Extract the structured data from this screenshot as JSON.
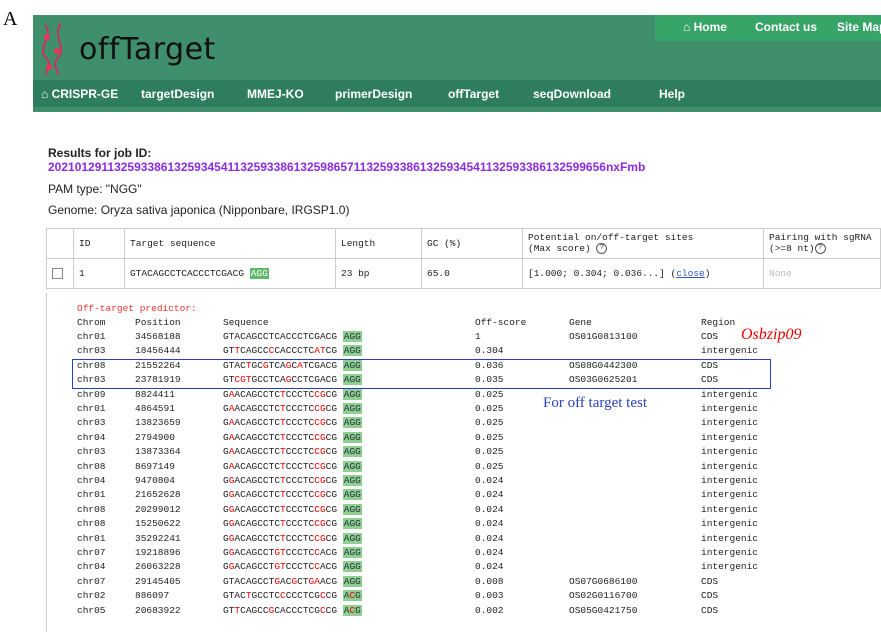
{
  "panel_label": "A",
  "logo": {
    "text": "offTarget"
  },
  "topnav": [
    {
      "label": "Home",
      "icon": "home-icon"
    },
    {
      "label": "Contact us"
    },
    {
      "label": "Site Map"
    }
  ],
  "mainnav": [
    {
      "label": "CRISPR-GE",
      "icon": "home-icon"
    },
    {
      "label": "targetDesign"
    },
    {
      "label": "MMEJ-KO"
    },
    {
      "label": "primerDesign"
    },
    {
      "label": "offTarget"
    },
    {
      "label": "seqDownload"
    },
    {
      "label": "Help"
    }
  ],
  "job": {
    "label": "Results for job ID:",
    "id": "20210129113259338613259345411325933861325986571132593386132593454113259338613259965​6nxFmb",
    "pam": "PAM type:  \"NGG\"",
    "genome": "Genome:  Oryza sativa japonica (Nipponbare, IRGSP1.0)"
  },
  "table": {
    "headers": [
      "ID",
      "Target sequence",
      "Length",
      "GC (%)",
      "Potential on/off-target sites",
      "(Max score)",
      "Pairing with sgRNA",
      "(>=8 nt)"
    ],
    "row": {
      "id": "1",
      "seq": "GTACAGCCTCACCCTCGACG",
      "pam": "AGG",
      "length": "23 bp",
      "gc": "65.0",
      "sites": "[1.000; 0.304; 0.036...] (",
      "sites_link": "close",
      "sites_end": ")",
      "pairing": "None"
    }
  },
  "offtarget": {
    "title": "Off-target predictor:",
    "columns": [
      "Chrom",
      "Position",
      "Sequence",
      "Off-score",
      "Gene",
      "Region"
    ],
    "rows": [
      {
        "chrom": "chr01",
        "pos": "34568188",
        "seq": "GTACAGCCTCACCCTCGACG",
        "pam": "AGG",
        "score": "1",
        "gene": "OS01G0813100",
        "region": "CDS"
      },
      {
        "chrom": "chr03",
        "pos": "18456444",
        "seq": "GTTCAGCCCCACCCTCATCG",
        "pam": "AGG",
        "score": "0.304",
        "gene": "",
        "region": "intergenic"
      },
      {
        "chrom": "chr08",
        "pos": "21552264",
        "seq": "GTACTGCGTCAGCATCGACG",
        "pam": "AGG",
        "score": "0.036",
        "gene": "OS08G0442300",
        "region": "CDS"
      },
      {
        "chrom": "chr03",
        "pos": "23781919",
        "seq": "GTCGTGCCTCAGCCTCGACG",
        "pam": "AGG",
        "score": "0.035",
        "gene": "OS03G0625201",
        "region": "CDS"
      },
      {
        "chrom": "chr09",
        "pos": "8824411",
        "seq": "GAACAGCCTCTCCCTCCGCG",
        "pam": "AGG",
        "score": "0.025",
        "gene": "",
        "region": "intergenic"
      },
      {
        "chrom": "chr01",
        "pos": "4864591",
        "seq": "GAACAGCCTCTCCCTCCGCG",
        "pam": "AGG",
        "score": "0.025",
        "gene": "",
        "region": "intergenic"
      },
      {
        "chrom": "chr03",
        "pos": "13823659",
        "seq": "GAACAGCCTCTCCCTCCGCG",
        "pam": "AGG",
        "score": "0.025",
        "gene": "",
        "region": "intergenic"
      },
      {
        "chrom": "chr04",
        "pos": "2794900",
        "seq": "GAACAGCCTCTCCCTCCGCG",
        "pam": "AGG",
        "score": "0.025",
        "gene": "",
        "region": "intergenic"
      },
      {
        "chrom": "chr03",
        "pos": "13873364",
        "seq": "GAACAGCCTCTCCCTCCGCG",
        "pam": "AGG",
        "score": "0.025",
        "gene": "",
        "region": "intergenic"
      },
      {
        "chrom": "chr08",
        "pos": "8697149",
        "seq": "GAACAGCCTCTCCCTCCGCG",
        "pam": "AGG",
        "score": "0.025",
        "gene": "",
        "region": "intergenic"
      },
      {
        "chrom": "chr04",
        "pos": "9470804",
        "seq": "GGACAGCCTCTCCCTCCGCG",
        "pam": "AGG",
        "score": "0.024",
        "gene": "",
        "region": "intergenic"
      },
      {
        "chrom": "chr01",
        "pos": "21652628",
        "seq": "GGACAGCCTCTCCCTCCGCG",
        "pam": "AGG",
        "score": "0.024",
        "gene": "",
        "region": "intergenic"
      },
      {
        "chrom": "chr08",
        "pos": "20299012",
        "seq": "GGACAGCCTCTCCCTCCGCG",
        "pam": "AGG",
        "score": "0.024",
        "gene": "",
        "region": "intergenic"
      },
      {
        "chrom": "chr08",
        "pos": "15250622",
        "seq": "GGACAGCCTCTCCCTCCGCG",
        "pam": "AGG",
        "score": "0.024",
        "gene": "",
        "region": "intergenic"
      },
      {
        "chrom": "chr01",
        "pos": "35292241",
        "seq": "GGACAGCCTCTCCCTCCGCG",
        "pam": "AGG",
        "score": "0.024",
        "gene": "",
        "region": "intergenic"
      },
      {
        "chrom": "chr07",
        "pos": "19218896",
        "seq": "GGACAGCCTGTCCCTCCACG",
        "pam": "AGG",
        "score": "0.024",
        "gene": "",
        "region": "intergenic"
      },
      {
        "chrom": "chr04",
        "pos": "26063228",
        "seq": "GGACAGCCTGTCCCTCCACG",
        "pam": "AGG",
        "score": "0.024",
        "gene": "",
        "region": "intergenic"
      },
      {
        "chrom": "chr07",
        "pos": "29145405",
        "seq": "GTACAGCCTGACGCTGAACG",
        "pam": "AGG",
        "score": "0.008",
        "gene": "OS07G0686100",
        "region": "CDS"
      },
      {
        "chrom": "chr02",
        "pos": "886097",
        "seq": "GTACTGCCTCCCCCTCGCCG",
        "pam": "ACG",
        "score": "0.003",
        "gene": "OS02G0116700",
        "region": "CDS"
      },
      {
        "chrom": "chr05",
        "pos": "20683922",
        "seq": "GTTCAGCCGCACCCTCGCCG",
        "pam": "ACG",
        "score": "0.002",
        "gene": "OS05G0421750",
        "region": "CDS"
      }
    ]
  },
  "annotations": {
    "gene_name": "Osbzip09",
    "box_note": "For off target test"
  },
  "colors": {
    "header_bg": "#3f8f6d",
    "nav_bg": "#2e7d5e",
    "pam_bg": "#5fb96a",
    "mismatch": "#e00000",
    "box": "#2a3fbf"
  }
}
